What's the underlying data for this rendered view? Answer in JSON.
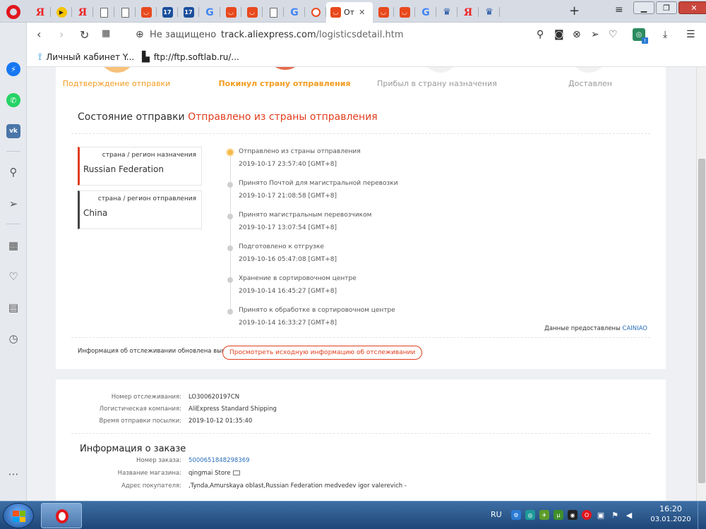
{
  "browser": {
    "tabs": [
      {
        "icon": "yandex-icon",
        "glyph": "Я"
      },
      {
        "icon": "play-icon",
        "glyph": "▶"
      },
      {
        "icon": "yandex-icon",
        "glyph": "Я"
      },
      {
        "icon": "document-icon",
        "glyph": ""
      },
      {
        "icon": "document-icon",
        "glyph": ""
      },
      {
        "icon": "aliexpress-icon",
        "glyph": "◡"
      },
      {
        "icon": "calendar-17-icon",
        "glyph": "17"
      },
      {
        "icon": "calendar-17-icon",
        "glyph": "17"
      },
      {
        "icon": "google-icon",
        "glyph": "G"
      },
      {
        "icon": "aliexpress-icon",
        "glyph": "◡"
      },
      {
        "icon": "aliexpress-icon",
        "glyph": "◡"
      },
      {
        "icon": "document-icon",
        "glyph": ""
      },
      {
        "icon": "google-icon",
        "glyph": "G"
      },
      {
        "icon": "search-page-icon",
        "glyph": ""
      }
    ],
    "active_tab": {
      "title": "От",
      "icon": "aliexpress-icon"
    },
    "tabs_after": [
      {
        "icon": "aliexpress-icon",
        "glyph": "◡"
      },
      {
        "icon": "aliexpress-icon",
        "glyph": "◡"
      },
      {
        "icon": "google-icon",
        "glyph": "G"
      },
      {
        "icon": "eagle-icon",
        "glyph": "♛"
      },
      {
        "icon": "yandex-icon",
        "glyph": "Я"
      },
      {
        "icon": "eagle-icon",
        "glyph": "♛"
      }
    ],
    "not_secure_label": "Не защищено",
    "url_domain": "track.aliexpress.com",
    "url_path": "/logisticsdetail.htm",
    "bookmarks": [
      {
        "label": "Личный кабинет Y...",
        "icon": "yota-icon"
      },
      {
        "label": "ftp://ftp.softlab.ru/...",
        "icon": "document-icon"
      }
    ]
  },
  "progress": {
    "steps": [
      {
        "label": "Подтверждение отправки",
        "state": "done"
      },
      {
        "label": "Покинул страну отправления",
        "state": "current"
      },
      {
        "label": "Прибыл в страну назначения",
        "state": "pending"
      },
      {
        "label": "Доставлен",
        "state": "pending"
      }
    ]
  },
  "shipment": {
    "status_prefix": "Состояние отправки",
    "status_value": "Отправлено из страны отправления",
    "destination": {
      "kind": "страна / регион назначения",
      "name": "Russian Federation"
    },
    "origin": {
      "kind": "страна / регион отправления",
      "name": "China"
    },
    "events": [
      {
        "text": "Отправлено из страны отправления",
        "time": "2019-10-17 23:57:40 [GMT+8]"
      },
      {
        "text": "Принято Почтой для магистральной перевозки",
        "time": "2019-10-17 21:08:58 [GMT+8]"
      },
      {
        "text": "Принято магистральным перевозчиком",
        "time": "2019-10-17 13:07:54 [GMT+8]"
      },
      {
        "text": "Подготовлено к отгрузке",
        "time": "2019-10-16 05:47:08 [GMT+8]"
      },
      {
        "text": "Хранение в сортировочном центре",
        "time": "2019-10-14 16:45:27 [GMT+8]"
      },
      {
        "text": "Принято к обработке в сортировочном центре",
        "time": "2019-10-14 16:33:27 [GMT+8]"
      }
    ],
    "provider_label": "Данные предоставлены",
    "provider_name": "CAINIAO",
    "updated_text": "Информация об отслеживании обновлена выше",
    "view_raw_label": "Просмотреть исходную информацию об отслеживании"
  },
  "details": {
    "tracking_label": "Номер отслеживания:",
    "tracking_value": "LO300620197CN",
    "company_label": "Логистическая компания:",
    "company_value": "AliExpress Standard Shipping",
    "sent_label": "Время отправки посылки:",
    "sent_value": "2019-10-12 01:35:40",
    "order_heading": "Информация о заказе",
    "order_no_label": "Номер заказа:",
    "order_no_value": "5000651848298369",
    "store_label": "Название магазина:",
    "store_value": "qingmai Store",
    "address_label": "Адрес покупателя:",
    "address_value": ",Tynda,Amurskaya oblast,Russian Federation medvedev igor valerevich -"
  },
  "taskbar": {
    "lang": "RU",
    "time": "16:20",
    "date": "03.01.2020"
  },
  "colors": {
    "accent_orange": "#f29c1f",
    "accent_red": "#e23d1d",
    "link_blue": "#2a6ebb"
  }
}
